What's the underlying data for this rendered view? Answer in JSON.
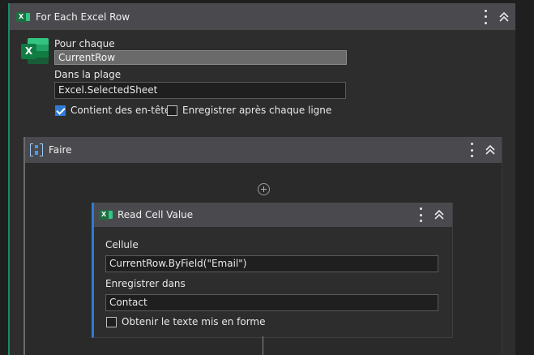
{
  "foreach": {
    "title": "For Each Excel Row",
    "icon": "excel-icon",
    "pour_chaque_label": "Pour chaque",
    "pour_chaque_value": "CurrentRow",
    "dans_la_plage_label": "Dans la plage",
    "dans_la_plage_value": "Excel.SelectedSheet",
    "contient_label": "Contient des en-têtes",
    "contient_checked": true,
    "enregistrer_label": "Enregistrer après chaque ligne",
    "enregistrer_checked": false
  },
  "faire": {
    "title": "Faire",
    "icon": "sequence-icon"
  },
  "read_cell": {
    "title": "Read Cell Value",
    "icon": "excel-icon",
    "cellule_label": "Cellule",
    "cellule_value": "CurrentRow.ByField(\"Email\")",
    "enregistrer_label": "Enregistrer dans",
    "enregistrer_value": "Contact",
    "obtenir_label": "Obtenir le texte mis en forme",
    "obtenir_checked": false
  },
  "colors": {
    "header_bg": "#4a4a4e",
    "panel_bg": "#2d2d2d",
    "accent_blue": "#2f7bd6",
    "accent_green": "#1a8a6a"
  }
}
